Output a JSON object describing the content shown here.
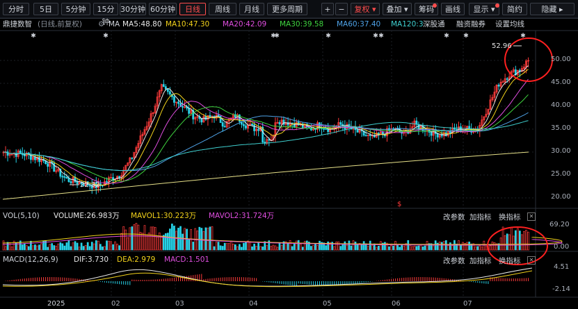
{
  "toolbar": {
    "periods": [
      "分时",
      "5日",
      "5分钟",
      "15分钟",
      "30分钟",
      "60分钟",
      "日线",
      "周线",
      "月线",
      "更多周期"
    ],
    "active_period": "日线",
    "plus": "+",
    "minus": "−",
    "buttons": [
      "复权",
      "叠加",
      "筹码",
      "画线",
      "显示",
      "简约",
      "隐藏"
    ]
  },
  "legend": {
    "stock": "鼎捷数智",
    "mode": "(日线,前复权)",
    "ma_label": "MA",
    "ma5": "MA5:48.80",
    "ma10": "MA10:47.30",
    "ma20": "MA20:42.09",
    "ma30": "MA30:39.58",
    "ma60": "MA60:37.40",
    "ma120": "MA120:3",
    "links": [
      "深股通",
      "融资融券",
      "设置均线"
    ]
  },
  "price_axis": [
    "50.00",
    "45.00",
    "40.00",
    "35.00",
    "30.00",
    "25.00",
    "20.00"
  ],
  "annotations": {
    "high": "52.96",
    "low": "22.32",
    "marker": "$"
  },
  "vol": {
    "title": "VOL(5,10)",
    "volume": "VOLUME:26.983万",
    "mavol1": "MAVOL1:30.223万",
    "mavol2": "MAVOL2:31.724万",
    "axis": [
      "69.20",
      "0.00"
    ],
    "actions": [
      "改参数",
      "加指标",
      "换指标"
    ]
  },
  "macd": {
    "title": "MACD(12,26,9)",
    "dif": "DIF:3.730",
    "dea": "DEA:2.979",
    "macd": "MACD:1.501",
    "axis": [
      "4.51",
      "-2.14"
    ],
    "actions": [
      "改参数",
      "加指标",
      "换指标"
    ]
  },
  "x_axis": [
    "2025",
    "02",
    "03",
    "04",
    "05",
    "06",
    "07"
  ],
  "colors": {
    "up": "#ff3b3b",
    "down": "#27d3e8",
    "ma5": "#e8e8e8",
    "ma10": "#f2d21b",
    "ma20": "#e04ee0",
    "ma30": "#3fd43f",
    "ma60": "#4fa3e8",
    "ma120": "#3fd0d0",
    "long": "#e8e28a",
    "highlight": "#ff2020"
  },
  "icons": {
    "settings": "gear-icon",
    "close": "close-icon"
  }
}
